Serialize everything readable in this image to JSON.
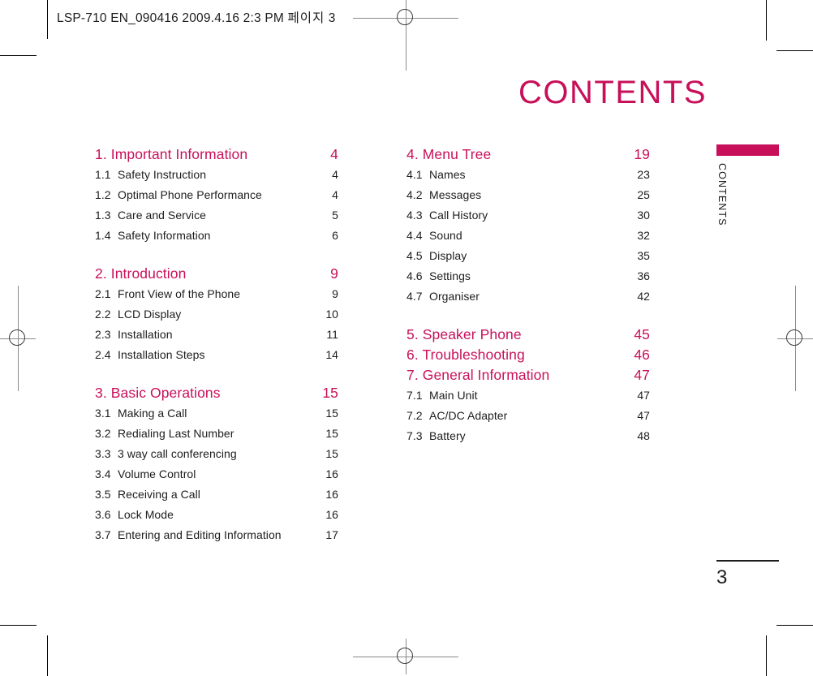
{
  "slug": {
    "text": "LSP-710 EN_090416  2009.4.16 2:3 PM",
    "korean": "페이지",
    "page_ref": "3"
  },
  "page_title": "CONTENTS",
  "thumb_tab": {
    "label": "CONTENTS",
    "color": "#C8105A"
  },
  "folio": {
    "page_number": "3"
  },
  "colors": {
    "accent": "#C8105A",
    "text": "#1d1d1d"
  },
  "toc": {
    "left_column": [
      {
        "chapter": {
          "label": "1. Important Information",
          "page": "4"
        },
        "entries": [
          {
            "num": "1.1",
            "label": "Safety Instruction",
            "page": "4"
          },
          {
            "num": "1.2",
            "label": "Optimal Phone Performance",
            "page": "4"
          },
          {
            "num": "1.3",
            "label": "Care and Service",
            "page": "5"
          },
          {
            "num": "1.4",
            "label": "Safety Information",
            "page": "6"
          }
        ]
      },
      {
        "chapter": {
          "label": "2. Introduction",
          "page": "9"
        },
        "entries": [
          {
            "num": "2.1",
            "label": "Front View of the Phone",
            "page": "9"
          },
          {
            "num": "2.2",
            "label": "LCD Display",
            "page": "10"
          },
          {
            "num": "2.3",
            "label": "Installation",
            "page": "11"
          },
          {
            "num": "2.4",
            "label": "Installation Steps",
            "page": "14"
          }
        ]
      },
      {
        "chapter": {
          "label": "3. Basic Operations",
          "page": "15"
        },
        "entries": [
          {
            "num": "3.1",
            "label": "Making a Call",
            "page": "15"
          },
          {
            "num": "3.2",
            "label": "Redialing Last Number",
            "page": "15"
          },
          {
            "num": "3.3",
            "label": "3 way call conferencing",
            "page": "15"
          },
          {
            "num": "3.4",
            "label": "Volume Control",
            "page": "16"
          },
          {
            "num": "3.5",
            "label": "Receiving a Call",
            "page": "16"
          },
          {
            "num": "3.6",
            "label": "Lock Mode",
            "page": "16"
          },
          {
            "num": "3.7",
            "label": "Entering and Editing Information",
            "page": "17"
          }
        ]
      }
    ],
    "right_column": [
      {
        "chapter": {
          "label": "4. Menu Tree",
          "page": "19"
        },
        "entries": [
          {
            "num": "4.1",
            "label": "Names",
            "page": "23"
          },
          {
            "num": "4.2",
            "label": "Messages",
            "page": "25"
          },
          {
            "num": "4.3",
            "label": "Call History",
            "page": "30"
          },
          {
            "num": "4.4",
            "label": "Sound",
            "page": "32"
          },
          {
            "num": "4.5",
            "label": "Display",
            "page": "35"
          },
          {
            "num": "4.6",
            "label": "Settings",
            "page": "36"
          },
          {
            "num": "4.7",
            "label": "Organiser",
            "page": "42"
          }
        ]
      },
      {
        "chapter": {
          "label": "5. Speaker Phone",
          "page": "45"
        },
        "entries": []
      },
      {
        "chapter": {
          "label": "6. Troubleshooting",
          "page": "46"
        },
        "entries": []
      },
      {
        "chapter": {
          "label": "7. General Information",
          "page": "47"
        },
        "entries": [
          {
            "num": "7.1",
            "label": "Main Unit",
            "page": "47"
          },
          {
            "num": "7.2",
            "label": "AC/DC Adapter",
            "page": "47"
          },
          {
            "num": "7.3",
            "label": "Battery",
            "page": "48"
          }
        ]
      }
    ]
  }
}
